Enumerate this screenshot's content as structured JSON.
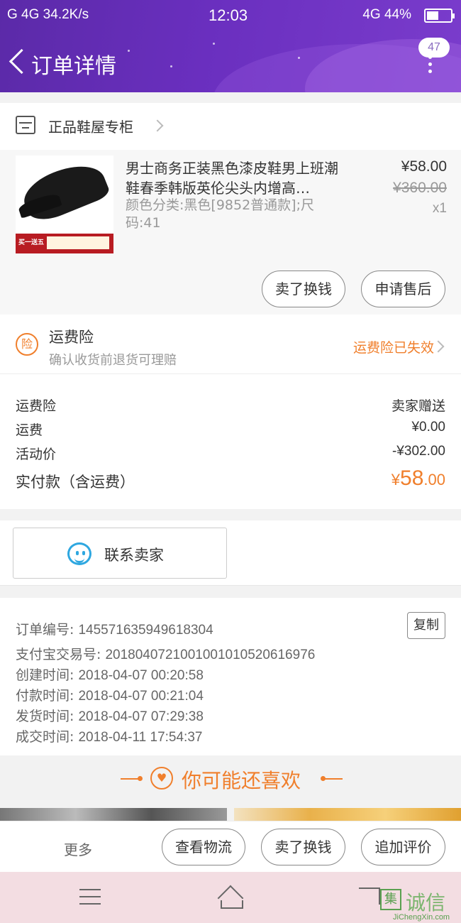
{
  "status_bar": {
    "left": "G 4G 34.2K/s",
    "time": "12:03",
    "right": "4G 44%"
  },
  "header": {
    "title": "订单详情",
    "badge_count": "47"
  },
  "shop": {
    "name": "正品鞋屋专柜"
  },
  "product": {
    "image_text": "买一送五",
    "title": "男士商务正装黑色漆皮鞋男上班潮鞋春季韩版英伦尖头内增高…",
    "sku": "颜色分类:黑色[9852普通款];尺码:41",
    "price": "¥58.00",
    "original_price": "¥360.00",
    "quantity": "x1",
    "actions": [
      "卖了换钱",
      "申请售后"
    ]
  },
  "insurance": {
    "icon_char": "险",
    "title": "运费险",
    "subtitle": "确认收货前退货可理赔",
    "status": "运费险已失效"
  },
  "fees": {
    "rows": [
      {
        "label": "运费险",
        "value": "卖家赠送"
      },
      {
        "label": "运费",
        "value": "¥0.00"
      },
      {
        "label": "活动价",
        "value": "-¥302.00"
      }
    ],
    "total_label": "实付款（含运费）",
    "total_currency": "¥",
    "total_int": "58",
    "total_dec": ".00"
  },
  "contact": {
    "label": "联系卖家"
  },
  "order_info": {
    "copy_label": "复制",
    "rows": [
      {
        "label": "订单编号: ",
        "value": "145571635949618304"
      },
      {
        "label": "支付宝交易号: ",
        "value": "2018040721001001010520616976"
      },
      {
        "label": "创建时间: ",
        "value": "2018-04-07 00:20:58"
      },
      {
        "label": "付款时间: ",
        "value": "2018-04-07 00:21:04"
      },
      {
        "label": "发货时间: ",
        "value": "2018-04-07 07:29:38"
      },
      {
        "label": "成交时间: ",
        "value": "2018-04-11 17:54:37"
      }
    ]
  },
  "recommend": {
    "icon_char": "♥",
    "title": "你可能还喜欢"
  },
  "bottom_actions": {
    "more": "更多",
    "buttons": [
      "查看物流",
      "卖了换钱",
      "追加评价"
    ]
  },
  "watermark": {
    "icon_char": "集",
    "text": "诚信",
    "sub": "JiChengXin.com"
  },
  "colors": {
    "header_purple": "#6a2fbf",
    "accent_orange": "#f07f2c",
    "contact_blue": "#2ea7e0"
  }
}
